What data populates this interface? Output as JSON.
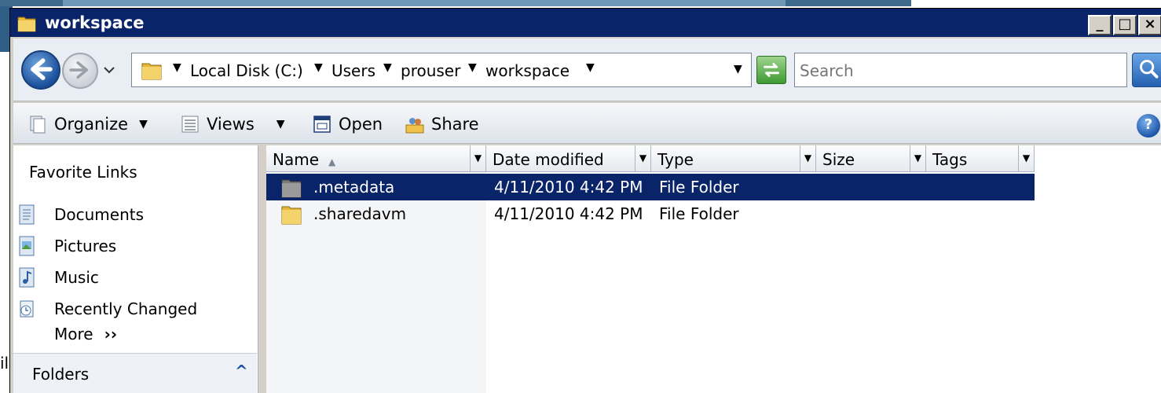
{
  "window": {
    "title": "workspace"
  },
  "background": {
    "left_fragment": "il"
  },
  "address_bar": {
    "breadcrumbs": [
      "Local Disk (C:)",
      "Users",
      "prouser",
      "workspace"
    ]
  },
  "search": {
    "placeholder": "Search"
  },
  "toolbar": {
    "organize_label": "Organize",
    "views_label": "Views",
    "open_label": "Open",
    "share_label": "Share"
  },
  "nav_pane": {
    "heading": "Favorite Links",
    "items": [
      {
        "label": "Documents",
        "icon": "documents-icon"
      },
      {
        "label": "Pictures",
        "icon": "pictures-icon"
      },
      {
        "label": "Music",
        "icon": "music-icon"
      },
      {
        "label": "Recently Changed",
        "icon": "recently-changed-icon"
      }
    ],
    "more_label": "More",
    "folders_label": "Folders"
  },
  "file_list": {
    "columns": [
      "Name",
      "Date modified",
      "Type",
      "Size",
      "Tags"
    ],
    "rows": [
      {
        "name": ".metadata",
        "date": "4/11/2010 4:42 PM",
        "type": "File Folder",
        "size": "",
        "tags": "",
        "selected": true
      },
      {
        "name": ".sharedavm",
        "date": "4/11/2010 4:42 PM",
        "type": "File Folder",
        "size": "",
        "tags": "",
        "selected": false
      }
    ]
  },
  "colors": {
    "titlebar": "#0a246a",
    "selection": "#0a246a",
    "window_face": "#d4d0c8"
  }
}
